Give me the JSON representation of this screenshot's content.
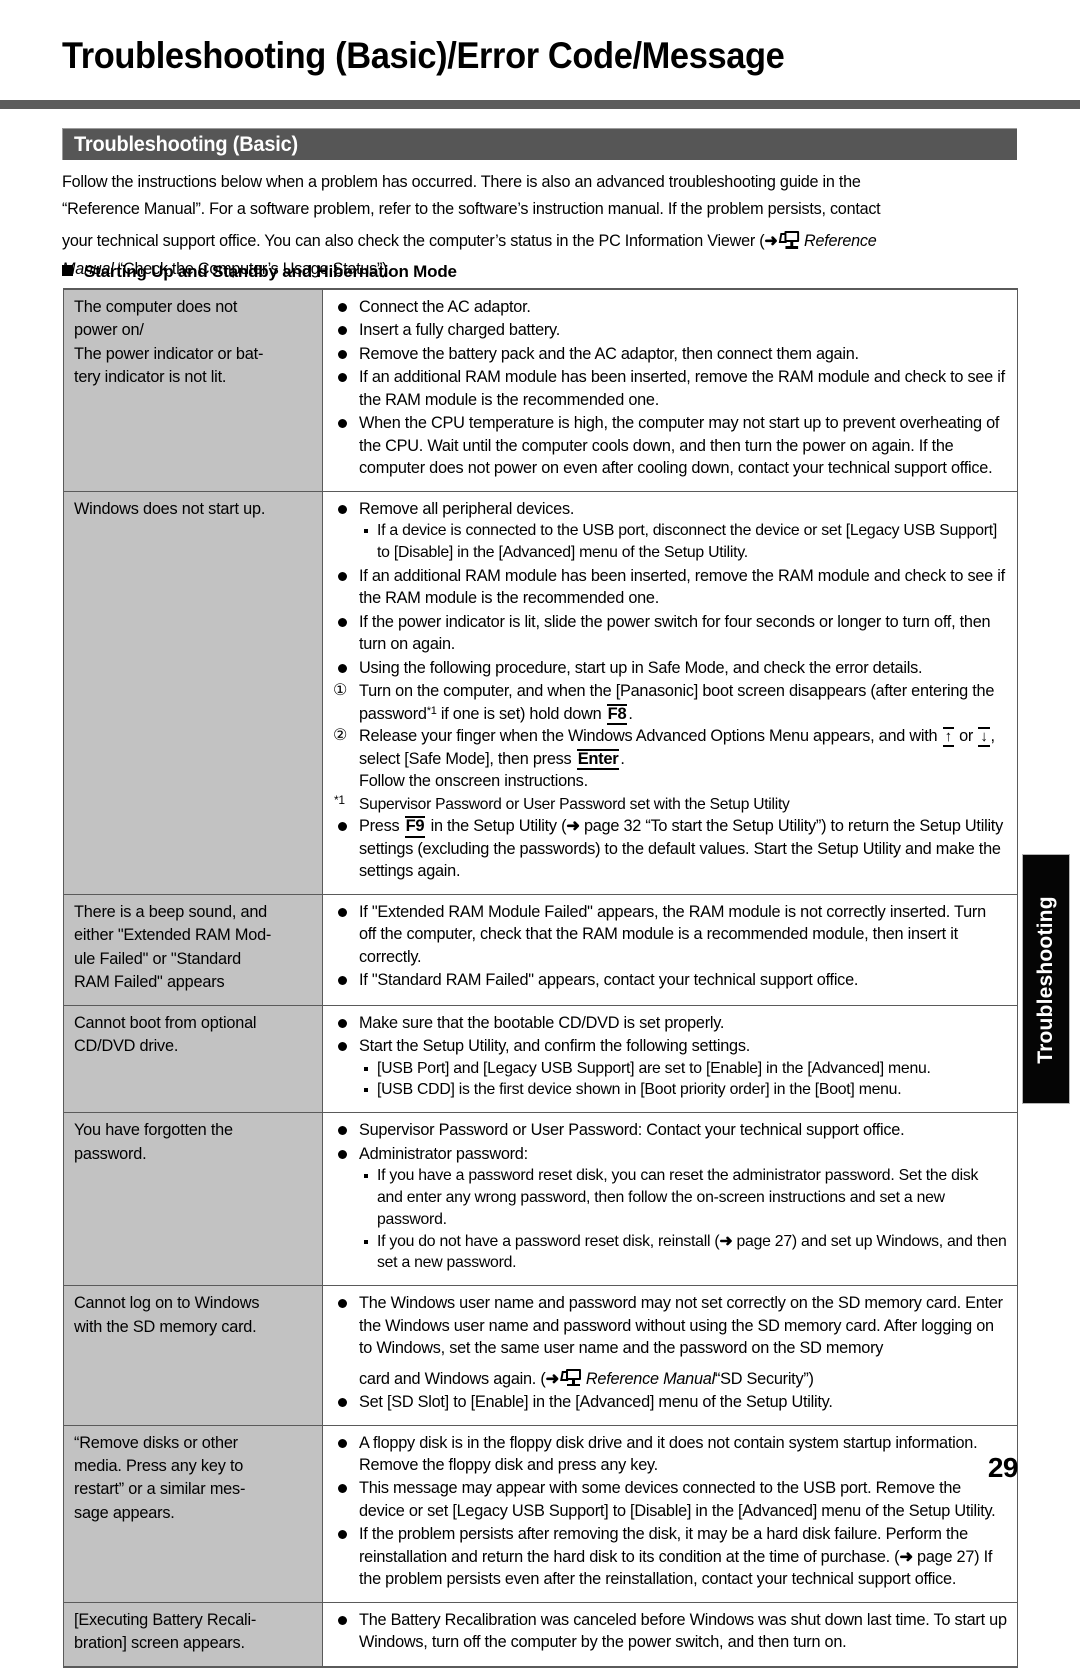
{
  "page": {
    "title": "Troubleshooting (Basic)/Error Code/Message",
    "number": "29",
    "side_tab": "Troubleshooting",
    "accent_dark": "#5c5c5c",
    "section_bar_color": "#565656",
    "row_label_bg": "#c2c2c2"
  },
  "section": {
    "heading": "Troubleshooting (Basic)"
  },
  "intro": {
    "line1": "Follow the instructions below when a problem has occurred. There is also an advanced troubleshooting guide in the",
    "line2": "“Reference Manual”. For a software problem, refer to the software’s instruction manual. If the problem persists, contact",
    "line3_a": "your technical support office. You can also check the computer’s status in the PC Information Viewer (",
    "line3_arrow": "➜",
    "line3_icon": "reference-manual-icon",
    "line3_b": "Reference",
    "line4_a": "Manual",
    "line4_b": "“Check the Computer’s Usage Status”)."
  },
  "subheading": {
    "label": "Starting Up and Standby and Hibernation Mode",
    "marker": "filled-square"
  },
  "table": {
    "rows": [
      {
        "symptom": [
          "The computer does not",
          "power on/",
          "The power indicator or bat-",
          "tery indicator is not lit."
        ],
        "items": [
          {
            "type": "bullet",
            "text": "Connect the AC adaptor."
          },
          {
            "type": "bullet",
            "text": "Insert a fully charged battery."
          },
          {
            "type": "bullet",
            "text": "Remove the battery pack and the AC adaptor, then connect them again."
          },
          {
            "type": "bullet",
            "text": "If an additional RAM module has been inserted, remove the RAM module and check to see if the RAM module is the recommended one."
          },
          {
            "type": "bullet",
            "text": "When the CPU temperature is high, the computer may not start up to prevent overheating of the CPU. Wait until the computer cools down, and then turn the power on again. If the computer does not power on even after cooling down, contact your technical support office."
          }
        ]
      },
      {
        "symptom": [
          "Windows does not start up."
        ],
        "items": [
          {
            "type": "bullet",
            "text": "Remove all peripheral devices."
          },
          {
            "type": "sub",
            "text": "If a device is connected to the USB port, disconnect the device or set [Legacy USB Support] to [Disable] in the [Advanced] menu of the Setup Utility."
          },
          {
            "type": "bullet",
            "text": "If an additional RAM module has been inserted, remove the RAM module and check to see if the RAM module is the recommended one."
          },
          {
            "type": "bullet",
            "text": "If the power indicator is lit, slide the power switch for four seconds or longer to turn off, then turn on again."
          },
          {
            "type": "bullet",
            "text": "Using the following procedure, start up in Safe Mode, and check the error details."
          }
        ],
        "steps": [
          {
            "num": "①",
            "before": "Turn on the computer, and when the [Panasonic] boot screen disappears (after entering the password",
            "footnote": "*1",
            "middle": " if one is set) hold down ",
            "key": "F8",
            "after": "."
          },
          {
            "num": "②",
            "before": "Release your finger when the Windows Advanced Options Menu appears, and with ",
            "key_up": "↑",
            "mid1": " or ",
            "key_down": "↓",
            "mid2": ", select [Safe Mode], then press ",
            "key": "Enter",
            "after": "."
          }
        ],
        "steps_follow": "Follow the onscreen instructions.",
        "footnote": {
          "mark": "*1",
          "text": "Supervisor Password or User Password set with the Setup Utility"
        },
        "trailing": [
          {
            "type": "bullet-key",
            "before": "Press ",
            "key": "F9",
            "after_a": " in the Setup Utility (",
            "arrow": "➜",
            "after_b": " page 32 “To start the Setup Utility”) to return the Setup Utility settings (excluding the passwords) to the default values. Start the Setup Utility and make the settings again."
          }
        ]
      },
      {
        "symptom": [
          "There is a beep sound, and",
          "either \"Extended RAM Mod-",
          "ule Failed\" or \"Standard",
          "RAM Failed\" appears"
        ],
        "items": [
          {
            "type": "bullet",
            "text": "If \"Extended RAM Module Failed\" appears, the RAM module is not correctly inserted. Turn off the computer, check that the RAM module is a recommended module, then insert it correctly."
          },
          {
            "type": "bullet",
            "text": "If \"Standard RAM Failed\" appears, contact your technical support office."
          }
        ]
      },
      {
        "symptom": [
          "Cannot boot from optional",
          "CD/DVD drive."
        ],
        "items": [
          {
            "type": "bullet",
            "text": "Make sure that the bootable CD/DVD is set properly."
          },
          {
            "type": "bullet",
            "text": "Start the Setup Utility, and confirm the following settings."
          },
          {
            "type": "sub",
            "text": "[USB Port] and [Legacy USB Support] are set to [Enable] in the [Advanced] menu."
          },
          {
            "type": "sub",
            "text": "[USB CDD] is the first device shown in [Boot priority order] in the [Boot] menu."
          }
        ]
      },
      {
        "symptom": [
          "You have forgotten the",
          "password."
        ],
        "items": [
          {
            "type": "bullet",
            "text": "Supervisor Password or User Password: Contact your technical support office."
          },
          {
            "type": "bullet",
            "text": "Administrator password:"
          },
          {
            "type": "sub",
            "text": "If you have a password reset disk, you can reset the administrator password. Set the disk and enter any wrong password, then follow the on-screen instructions and set a new password."
          },
          {
            "type": "sub-ref",
            "before": "If you do not have a password reset disk, reinstall (",
            "arrow": "➜",
            "after": " page 27) and set up Windows, and then set a new password."
          }
        ]
      },
      {
        "symptom": [
          "Cannot log on to Windows",
          "with the SD memory card."
        ],
        "items": [
          {
            "type": "bullet-ref-manual",
            "text_a": "The Windows user name and password may not set correctly on the SD memory card. Enter the Windows user name and password without using the SD memory card. After logging on to Windows, set the same user name and the password on the SD memory",
            "text_b": "card and Windows again. (",
            "arrow": "➜",
            "icon": "reference-manual-icon",
            "italic": "Reference Manual",
            "text_c": "“SD Security”)"
          },
          {
            "type": "bullet",
            "text": "Set [SD Slot] to [Enable] in the [Advanced] menu of the Setup Utility."
          }
        ]
      },
      {
        "symptom": [
          "“Remove disks or other",
          "media. Press any key to",
          "restart” or a similar mes-",
          "sage appears."
        ],
        "items": [
          {
            "type": "bullet",
            "text": "A floppy disk is in the floppy disk drive and it does not contain system startup information. Remove the floppy disk and press any key."
          },
          {
            "type": "bullet",
            "text": "This message may appear with some devices connected to the USB port. Remove the device or set [Legacy USB Support] to [Disable] in the [Advanced] menu of the Setup Utility."
          },
          {
            "type": "bullet-ref",
            "before": "If the problem persists after removing the disk, it may be a hard disk failure. Perform the reinstallation and return the hard disk to its condition at the time of purchase. (",
            "arrow": "➜",
            "after": " page 27) If the problem persists even after the reinstallation, contact your technical support office."
          }
        ]
      },
      {
        "symptom": [
          "[Executing Battery Recali-",
          "bration] screen appears."
        ],
        "items": [
          {
            "type": "bullet",
            "text": "The Battery Recalibration was canceled before Windows was shut down last time. To start up Windows, turn off the computer by the power switch, and then turn on."
          }
        ]
      }
    ]
  }
}
